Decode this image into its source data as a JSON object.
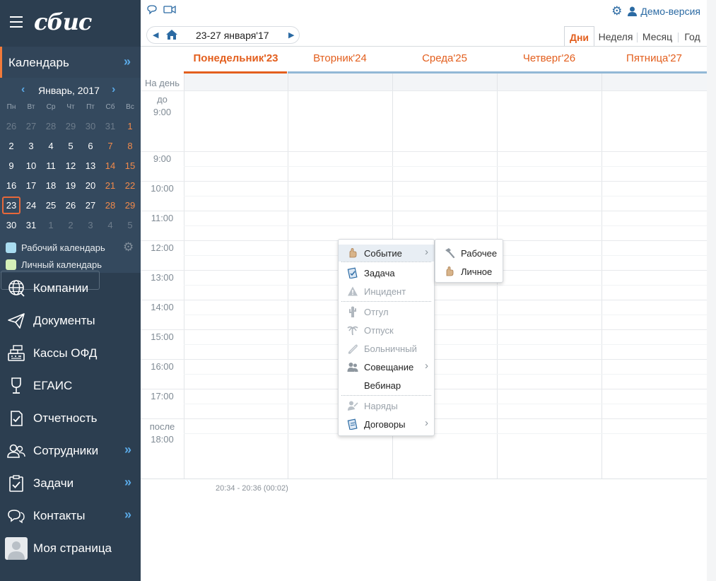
{
  "app": {
    "logo": "сбис"
  },
  "header": {
    "demo_label": "Демо-версия",
    "date_range": "23-27 января'17"
  },
  "views": [
    "Дни",
    "Неделя",
    "Месяц",
    "Год"
  ],
  "sidebar": {
    "calendar_title": "Календарь",
    "mini_calendar": {
      "month_label": "Январь, 2017",
      "weekdays": [
        "Пн",
        "Вт",
        "Ср",
        "Чт",
        "Пт",
        "Сб",
        "Вс"
      ],
      "weeks": [
        [
          "26",
          "27",
          "28",
          "29",
          "30",
          "31",
          "1"
        ],
        [
          "2",
          "3",
          "4",
          "5",
          "6",
          "7",
          "8"
        ],
        [
          "9",
          "10",
          "11",
          "12",
          "13",
          "14",
          "15"
        ],
        [
          "16",
          "17",
          "18",
          "19",
          "20",
          "21",
          "22"
        ],
        [
          "23",
          "24",
          "25",
          "26",
          "27",
          "28",
          "29"
        ],
        [
          "30",
          "31",
          "1",
          "2",
          "3",
          "4",
          "5"
        ]
      ],
      "today": "23"
    },
    "calendars": [
      {
        "label": "Рабочий календарь",
        "color": "#a9dcf0"
      },
      {
        "label": "Личный календарь",
        "color": "#d4f0b9"
      }
    ],
    "nav": [
      {
        "label": "Компании",
        "icon": "globe-icon",
        "more": false
      },
      {
        "label": "Документы",
        "icon": "paper-plane-icon",
        "more": false
      },
      {
        "label": "Кассы ОФД",
        "icon": "cash-register-icon",
        "more": false
      },
      {
        "label": "ЕГАИС",
        "icon": "wine-glass-icon",
        "more": false
      },
      {
        "label": "Отчетность",
        "icon": "report-check-icon",
        "more": false
      },
      {
        "label": "Сотрудники",
        "icon": "people-icon",
        "more": true
      },
      {
        "label": "Задачи",
        "icon": "clipboard-check-icon",
        "more": true
      },
      {
        "label": "Контакты",
        "icon": "chat-bubbles-icon",
        "more": true
      },
      {
        "label": "Моя страница",
        "icon": "avatar-icon",
        "more": false
      }
    ]
  },
  "days": [
    "Понедельник'23",
    "Вторник'24",
    "Среда'25",
    "Четверг'26",
    "Пятница'27"
  ],
  "time_labels": {
    "allday": "На день",
    "before_top": "до",
    "before_bottom": "9:00",
    "hours": [
      "9:00",
      "10:00",
      "11:00",
      "12:00",
      "13:00",
      "14:00",
      "15:00",
      "16:00",
      "17:00"
    ],
    "after_top": "после",
    "after_bottom": "18:00"
  },
  "timing": "20:34 - 20:36 (00:02)",
  "context_menu": {
    "items": [
      {
        "label": "Событие",
        "icon": "event-hand-icon",
        "disabled": false,
        "submenu": true
      },
      {
        "label": "Задача",
        "icon": "task-icon",
        "disabled": false,
        "submenu": false
      },
      {
        "label": "Инцидент",
        "icon": "warning-icon",
        "disabled": true,
        "submenu": false
      },
      {
        "label": "Отгул",
        "icon": "cactus-icon",
        "disabled": true,
        "submenu": false
      },
      {
        "label": "Отпуск",
        "icon": "palm-icon",
        "disabled": true,
        "submenu": false
      },
      {
        "label": "Больничный",
        "icon": "thermometer-icon",
        "disabled": true,
        "submenu": false
      },
      {
        "label": "Совещание",
        "icon": "meeting-icon",
        "disabled": false,
        "submenu": true
      },
      {
        "label": "Вебинар",
        "icon": "",
        "disabled": false,
        "submenu": false
      },
      {
        "label": "Наряды",
        "icon": "work-order-icon",
        "disabled": true,
        "submenu": false
      },
      {
        "label": "Договоры",
        "icon": "contract-icon",
        "disabled": false,
        "submenu": true
      }
    ]
  },
  "submenu": {
    "items": [
      {
        "label": "Рабочее",
        "icon": "hammer-icon"
      },
      {
        "label": "Личное",
        "icon": "hand-icon"
      }
    ]
  }
}
